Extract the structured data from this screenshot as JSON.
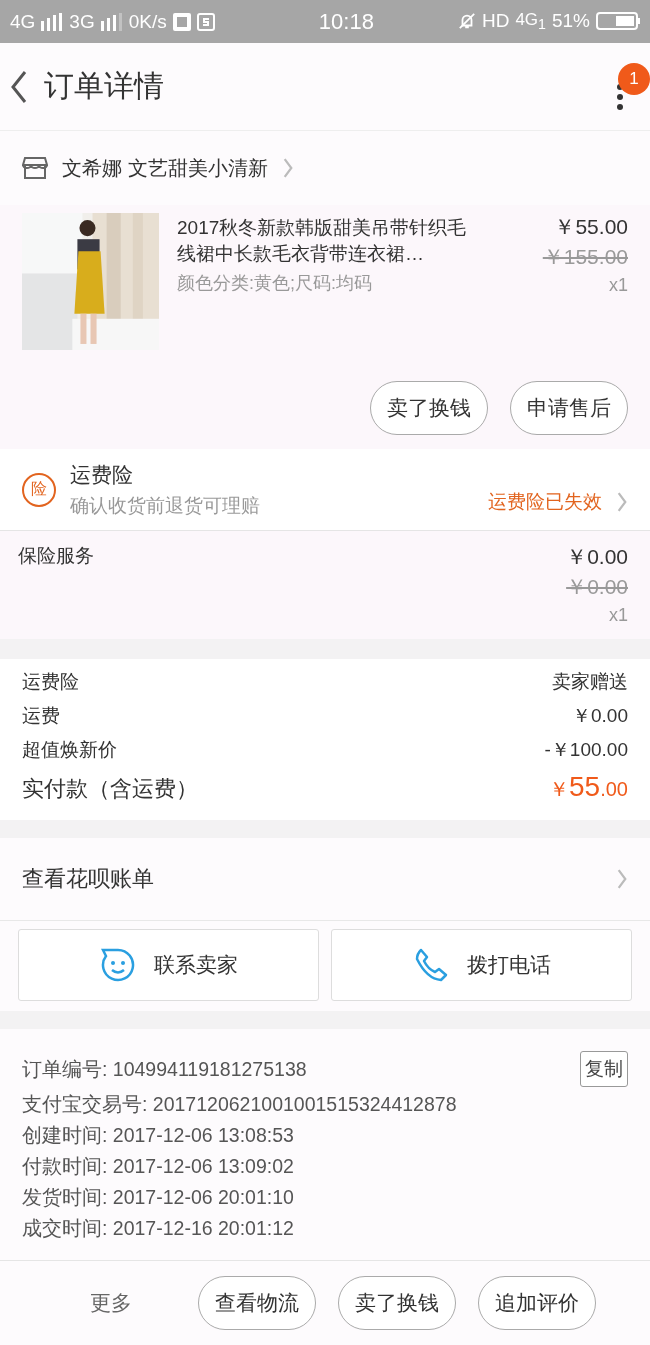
{
  "status_bar": {
    "network_1": "4G",
    "network_2": "3G",
    "speed": "0K/s",
    "time": "10:18",
    "hd": "HD",
    "network_3": "4G$_{1}$",
    "battery": "51%"
  },
  "header": {
    "title": "订单详情",
    "badge": "1"
  },
  "shop": {
    "name": "文希娜 文艺甜美小清新"
  },
  "product": {
    "title": "2017秋冬新款韩版甜美吊带针织毛线裙中长款毛衣背带连衣裙…",
    "sku": "颜色分类:黄色;尺码:均码",
    "price": "￥55.00",
    "original_price": "￥155.00",
    "quantity": "x1",
    "actions": [
      "卖了换钱",
      "申请售后"
    ]
  },
  "insurance": {
    "badge": "险",
    "title": "运费险",
    "subtitle": "确认收货前退货可理赔",
    "status": "运费险已失效"
  },
  "insurance_service": {
    "name": "保险服务",
    "price": "￥0.00",
    "original_price": "￥0.00",
    "quantity": "x1"
  },
  "fees": [
    {
      "label": "运费险",
      "value": "卖家赠送"
    },
    {
      "label": "运费",
      "value": "￥0.00"
    },
    {
      "label": "超值焕新价",
      "value": "-￥100.00"
    }
  ],
  "total": {
    "label": "实付款（含运费）",
    "currency": "￥",
    "integer": "55",
    "decimal": ".00"
  },
  "huabei": {
    "label": "查看花呗账单"
  },
  "contact_buttons": [
    {
      "kind": "chat",
      "label": "联系卖家"
    },
    {
      "kind": "phone",
      "label": "拨打电话"
    }
  ],
  "order_info": {
    "order_number": "订单编号: 104994119181275138",
    "copy": "复制",
    "lines": [
      "支付宝交易号: 2017120621001001515324412878",
      "创建时间: 2017-12-06 13:08:53",
      "付款时间: 2017-12-06 13:09:02",
      "发货时间: 2017-12-06 20:01:10",
      "成交时间: 2017-12-16 20:01:12"
    ]
  },
  "bottom_bar": {
    "more": "更多",
    "buttons": [
      "查看物流",
      "卖了换钱",
      "追加评价"
    ]
  }
}
